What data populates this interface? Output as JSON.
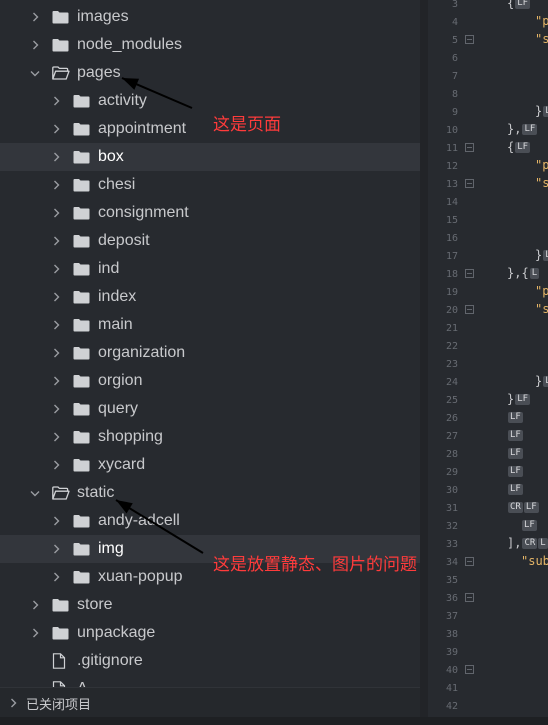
{
  "explorer": {
    "rows": [
      {
        "label": "images",
        "kind": "folder",
        "expanded": false,
        "depth": 0
      },
      {
        "label": "node_modules",
        "kind": "folder",
        "expanded": false,
        "depth": 0
      },
      {
        "label": "pages",
        "kind": "folder",
        "expanded": true,
        "depth": 0
      },
      {
        "label": "activity",
        "kind": "folder",
        "expanded": false,
        "depth": 1
      },
      {
        "label": "appointment",
        "kind": "folder",
        "expanded": false,
        "depth": 1
      },
      {
        "label": "box",
        "kind": "folder",
        "expanded": false,
        "depth": 1,
        "hovered": true
      },
      {
        "label": "chesi",
        "kind": "folder",
        "expanded": false,
        "depth": 1
      },
      {
        "label": "consignment",
        "kind": "folder",
        "expanded": false,
        "depth": 1
      },
      {
        "label": "deposit",
        "kind": "folder",
        "expanded": false,
        "depth": 1
      },
      {
        "label": "ind",
        "kind": "folder",
        "expanded": false,
        "depth": 1
      },
      {
        "label": "index",
        "kind": "folder",
        "expanded": false,
        "depth": 1
      },
      {
        "label": "main",
        "kind": "folder",
        "expanded": false,
        "depth": 1
      },
      {
        "label": "organization",
        "kind": "folder",
        "expanded": false,
        "depth": 1
      },
      {
        "label": "orgion",
        "kind": "folder",
        "expanded": false,
        "depth": 1
      },
      {
        "label": "query",
        "kind": "folder",
        "expanded": false,
        "depth": 1
      },
      {
        "label": "shopping",
        "kind": "folder",
        "expanded": false,
        "depth": 1
      },
      {
        "label": "xycard",
        "kind": "folder",
        "expanded": false,
        "depth": 1
      },
      {
        "label": "static",
        "kind": "folder",
        "expanded": true,
        "depth": 0
      },
      {
        "label": "andy-adcell",
        "kind": "folder",
        "expanded": false,
        "depth": 1
      },
      {
        "label": "img",
        "kind": "folder",
        "expanded": false,
        "depth": 1,
        "selected": true
      },
      {
        "label": "xuan-popup",
        "kind": "folder",
        "expanded": false,
        "depth": 1
      },
      {
        "label": "store",
        "kind": "folder",
        "expanded": false,
        "depth": 0
      },
      {
        "label": "unpackage",
        "kind": "folder",
        "expanded": false,
        "depth": 0
      },
      {
        "label": ".gitignore",
        "kind": "file",
        "depth": 0
      },
      {
        "label": "A",
        "kind": "file",
        "depth": 0
      }
    ],
    "closed_projects_label": "已关闭项目"
  },
  "annotations": [
    {
      "text": "这是页面"
    },
    {
      "text": "这是放置静态、图片的问题"
    }
  ],
  "editor": {
    "lines": [
      {
        "num": "3",
        "fold": false,
        "indent": 0,
        "text": "{",
        "lf": "LF"
      },
      {
        "num": "4",
        "fold": false,
        "indent": 2,
        "text": "\"p",
        "lf": ""
      },
      {
        "num": "5",
        "fold": true,
        "indent": 2,
        "text": "\"s",
        "lf": ""
      },
      {
        "num": "6",
        "fold": false,
        "indent": 0,
        "text": "",
        "lf": ""
      },
      {
        "num": "7",
        "fold": false,
        "indent": 0,
        "text": "",
        "lf": ""
      },
      {
        "num": "8",
        "fold": false,
        "indent": 0,
        "text": "",
        "lf": ""
      },
      {
        "num": "9",
        "fold": false,
        "indent": 2,
        "text": "}",
        "lf": "L"
      },
      {
        "num": "10",
        "fold": false,
        "indent": 0,
        "text": "},",
        "lf": "LF"
      },
      {
        "num": "11",
        "fold": true,
        "indent": 0,
        "text": "{",
        "lf": "LF"
      },
      {
        "num": "12",
        "fold": false,
        "indent": 2,
        "text": "\"p",
        "lf": ""
      },
      {
        "num": "13",
        "fold": true,
        "indent": 2,
        "text": "\"s",
        "lf": ""
      },
      {
        "num": "14",
        "fold": false,
        "indent": 0,
        "text": "",
        "lf": ""
      },
      {
        "num": "15",
        "fold": false,
        "indent": 0,
        "text": "",
        "lf": ""
      },
      {
        "num": "16",
        "fold": false,
        "indent": 0,
        "text": "",
        "lf": ""
      },
      {
        "num": "17",
        "fold": false,
        "indent": 2,
        "text": "}",
        "lf": "L"
      },
      {
        "num": "18",
        "fold": true,
        "indent": 0,
        "text": "},{",
        "lf": "L"
      },
      {
        "num": "19",
        "fold": false,
        "indent": 2,
        "text": "\"p",
        "lf": ""
      },
      {
        "num": "20",
        "fold": true,
        "indent": 2,
        "text": "\"s",
        "lf": ""
      },
      {
        "num": "21",
        "fold": false,
        "indent": 0,
        "text": "",
        "lf": ""
      },
      {
        "num": "22",
        "fold": false,
        "indent": 0,
        "text": "",
        "lf": ""
      },
      {
        "num": "23",
        "fold": false,
        "indent": 0,
        "text": "",
        "lf": ""
      },
      {
        "num": "24",
        "fold": false,
        "indent": 2,
        "text": "}",
        "lf": "L"
      },
      {
        "num": "25",
        "fold": false,
        "indent": 0,
        "text": "}",
        "lf": "LF"
      },
      {
        "num": "26",
        "fold": false,
        "indent": 0,
        "text": "",
        "lf": "LF"
      },
      {
        "num": "27",
        "fold": false,
        "indent": 0,
        "text": "",
        "lf": "LF"
      },
      {
        "num": "28",
        "fold": false,
        "indent": 0,
        "text": "",
        "lf": "LF"
      },
      {
        "num": "29",
        "fold": false,
        "indent": 0,
        "text": "",
        "lf": "LF"
      },
      {
        "num": "30",
        "fold": false,
        "indent": 0,
        "text": "",
        "lf": "LF"
      },
      {
        "num": "31",
        "fold": false,
        "indent": 0,
        "text": "",
        "lf": "CR LF"
      },
      {
        "num": "32",
        "fold": false,
        "indent": 1,
        "text": "",
        "lf": "LF"
      },
      {
        "num": "33",
        "fold": false,
        "indent": 0,
        "text": "],",
        "lf": "CR L"
      },
      {
        "num": "34",
        "fold": true,
        "indent": 1,
        "text": "\"sub",
        "lf": ""
      },
      {
        "num": "35",
        "fold": false,
        "indent": 0,
        "text": "",
        "lf": ""
      },
      {
        "num": "36",
        "fold": true,
        "indent": 0,
        "text": "",
        "lf": ""
      },
      {
        "num": "37",
        "fold": false,
        "indent": 0,
        "text": "",
        "lf": ""
      },
      {
        "num": "38",
        "fold": false,
        "indent": 0,
        "text": "",
        "lf": ""
      },
      {
        "num": "39",
        "fold": false,
        "indent": 0,
        "text": "",
        "lf": ""
      },
      {
        "num": "40",
        "fold": true,
        "indent": 0,
        "text": "",
        "lf": ""
      },
      {
        "num": "41",
        "fold": false,
        "indent": 0,
        "text": "",
        "lf": ""
      },
      {
        "num": "42",
        "fold": false,
        "indent": 0,
        "text": "",
        "lf": ""
      }
    ]
  },
  "colors": {
    "background": "#272a2f",
    "selected_row": "#33363c",
    "annotation": "#ff3b3b",
    "string": "#e5b567"
  }
}
